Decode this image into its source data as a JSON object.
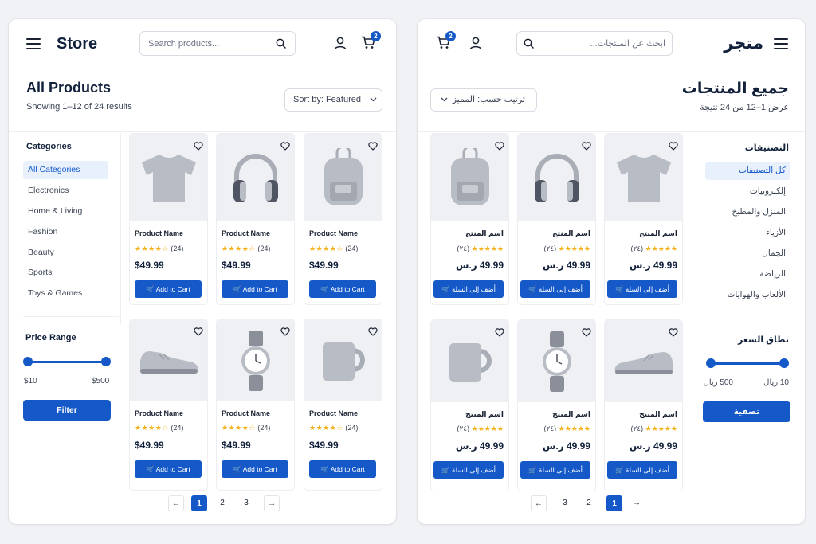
{
  "english": {
    "store_name": "Store",
    "search_placeholder": "Search products...",
    "cart_count": "2",
    "page_title": "All Products",
    "results_text": "Showing 1–12 of 24 results",
    "sort_label": "Sort by: Featured",
    "categories_title": "Categories",
    "categories": [
      "All Categories",
      "Electronics",
      "Home & Living",
      "Fashion",
      "Beauty",
      "Sports",
      "Toys & Games"
    ],
    "price_range_title": "Price Range",
    "price_min": "$10",
    "price_max": "$500",
    "filter_label": "Filter",
    "products": [
      {
        "name": "Product Name",
        "rating_count": "(24)",
        "price": "$49.99",
        "button": "Add to Cart",
        "image": "tshirt"
      },
      {
        "name": "Product Name",
        "rating_count": "(24)",
        "price": "$49.99",
        "button": "Add to Cart",
        "image": "headphones"
      },
      {
        "name": "Product Name",
        "rating_count": "(24)",
        "price": "$49.99",
        "button": "Add to Cart",
        "image": "backpack"
      },
      {
        "name": "Product Name",
        "rating_count": "(24)",
        "price": "$49.99",
        "button": "Add to Cart",
        "image": "sneaker"
      },
      {
        "name": "Product Name",
        "rating_count": "(24)",
        "price": "$49.99",
        "button": "Add to Cart",
        "image": "watch"
      },
      {
        "name": "Product Name",
        "rating_count": "(24)",
        "price": "$49.99",
        "button": "Add to Cart",
        "image": "mug"
      }
    ],
    "pagination": [
      "1",
      "2",
      "3"
    ],
    "current_page": "1"
  },
  "arabic": {
    "store_name": "متجر",
    "search_placeholder": "ابحث عن المنتجات...",
    "cart_count": "2",
    "page_title": "جميع المنتجات",
    "results_text": "عرض 1–12 من 24 نتيجة",
    "sort_label": "ترتيب حسب: المميز",
    "categories_title": "التصنيفات",
    "categories": [
      "كل التصنيفات",
      "إلكترونيات",
      "المنزل والمطبخ",
      "الأزياء",
      "الجمال",
      "الرياضة",
      "الألعاب والهوايات"
    ],
    "price_range_title": "نطاق السعر",
    "price_min": "10 ريال",
    "price_max": "500 ريال",
    "filter_label": "تصفية",
    "products": [
      {
        "name": "اسم المنتج",
        "rating_count": "(٢٤)",
        "price": "49.99 ر.س",
        "button": "أضف إلى السلة",
        "image": "tshirt"
      },
      {
        "name": "اسم المنتج",
        "rating_count": "(٢٤)",
        "price": "49.99 ر.س",
        "button": "أضف إلى السلة",
        "image": "headphones"
      },
      {
        "name": "اسم المنتج",
        "rating_count": "(٢٤)",
        "price": "49.99 ر.س",
        "button": "أضف إلى السلة",
        "image": "backpack"
      },
      {
        "name": "اسم المنتج",
        "rating_count": "(٢٤)",
        "price": "49.99 ر.س",
        "button": "أضف إلى السلة",
        "image": "sneaker"
      },
      {
        "name": "اسم المنتج",
        "rating_count": "(٢٤)",
        "price": "49.99 ر.س",
        "button": "أضف إلى السلة",
        "image": "watch"
      },
      {
        "name": "اسم المنتج",
        "rating_count": "(٢٤)",
        "price": "49.99 ر.س",
        "button": "أضف إلى السلة",
        "image": "mug"
      }
    ],
    "pagination": [
      "1",
      "2",
      "3"
    ],
    "current_page": "1"
  },
  "rating_stars": 4.5,
  "colors": {
    "accent": "#1559c9",
    "star": "#f3b21b",
    "image_bg": "#eef0f4",
    "active_bg": "#e8f0fc"
  }
}
